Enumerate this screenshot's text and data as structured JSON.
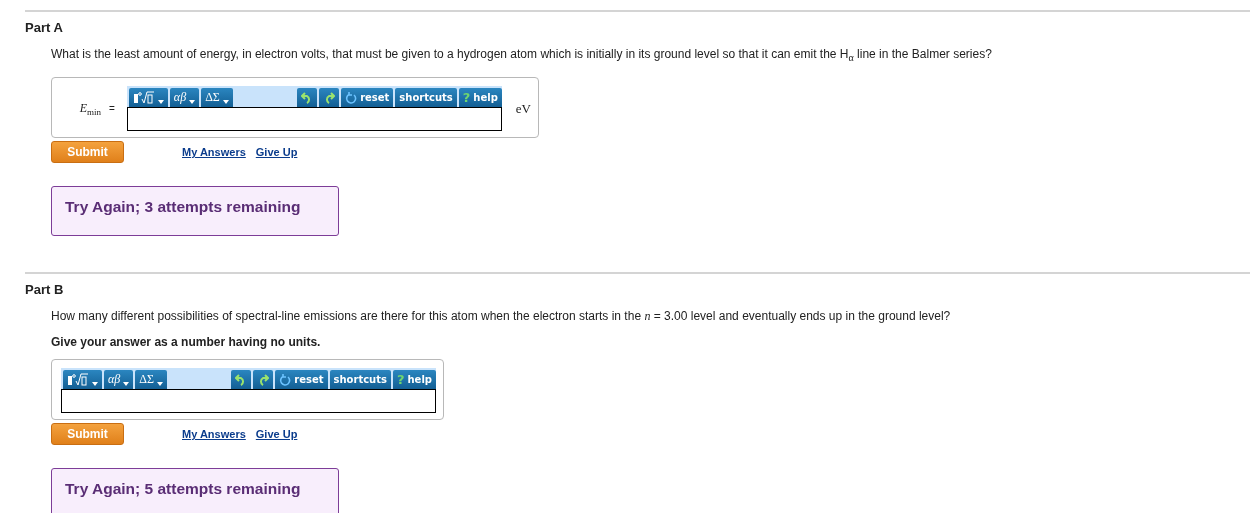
{
  "parts": [
    {
      "title": "Part A",
      "question": "What is the least amount of energy, in electron volts, that must be given to a hydrogen atom which is initially in its ground level so that it can emit the H$_{α}$ line in the Balmer series?",
      "answer": {
        "label": "*E*$_{min}$",
        "equals": "=",
        "unit": "eV",
        "toolbar": [
          {
            "kind": "template"
          },
          {
            "kind": "greek",
            "label": "αβ"
          },
          {
            "kind": "operators",
            "label": "ΔΣ"
          },
          {
            "kind": "undo"
          },
          {
            "kind": "redo"
          },
          {
            "kind": "reset",
            "label": "reset"
          },
          {
            "kind": "shortcuts",
            "label": "shortcuts"
          },
          {
            "kind": "help",
            "glyph": "?",
            "label": "help"
          }
        ]
      },
      "actions": {
        "submit": "Submit",
        "my_answers": "My Answers",
        "give_up": "Give Up"
      },
      "feedback": "Try Again; 3 attempts remaining"
    },
    {
      "title": "Part B",
      "question": "How many different possibilities of spectral-line emissions are there for this atom when the electron starts in the *n* = 3.00 level and eventually ends up in the ground level?",
      "instruction": "Give your answer as a number having no units.",
      "answer": {
        "toolbar": [
          {
            "kind": "template"
          },
          {
            "kind": "greek",
            "label": "αβ"
          },
          {
            "kind": "operators",
            "label": "ΔΣ"
          },
          {
            "kind": "undo"
          },
          {
            "kind": "redo"
          },
          {
            "kind": "reset",
            "label": "reset"
          },
          {
            "kind": "shortcuts",
            "label": "shortcuts"
          },
          {
            "kind": "help",
            "glyph": "?",
            "label": "help"
          }
        ]
      },
      "actions": {
        "submit": "Submit",
        "my_answers": "My Answers",
        "give_up": "Give Up"
      },
      "feedback": "Try Again; 5 attempts remaining"
    }
  ]
}
